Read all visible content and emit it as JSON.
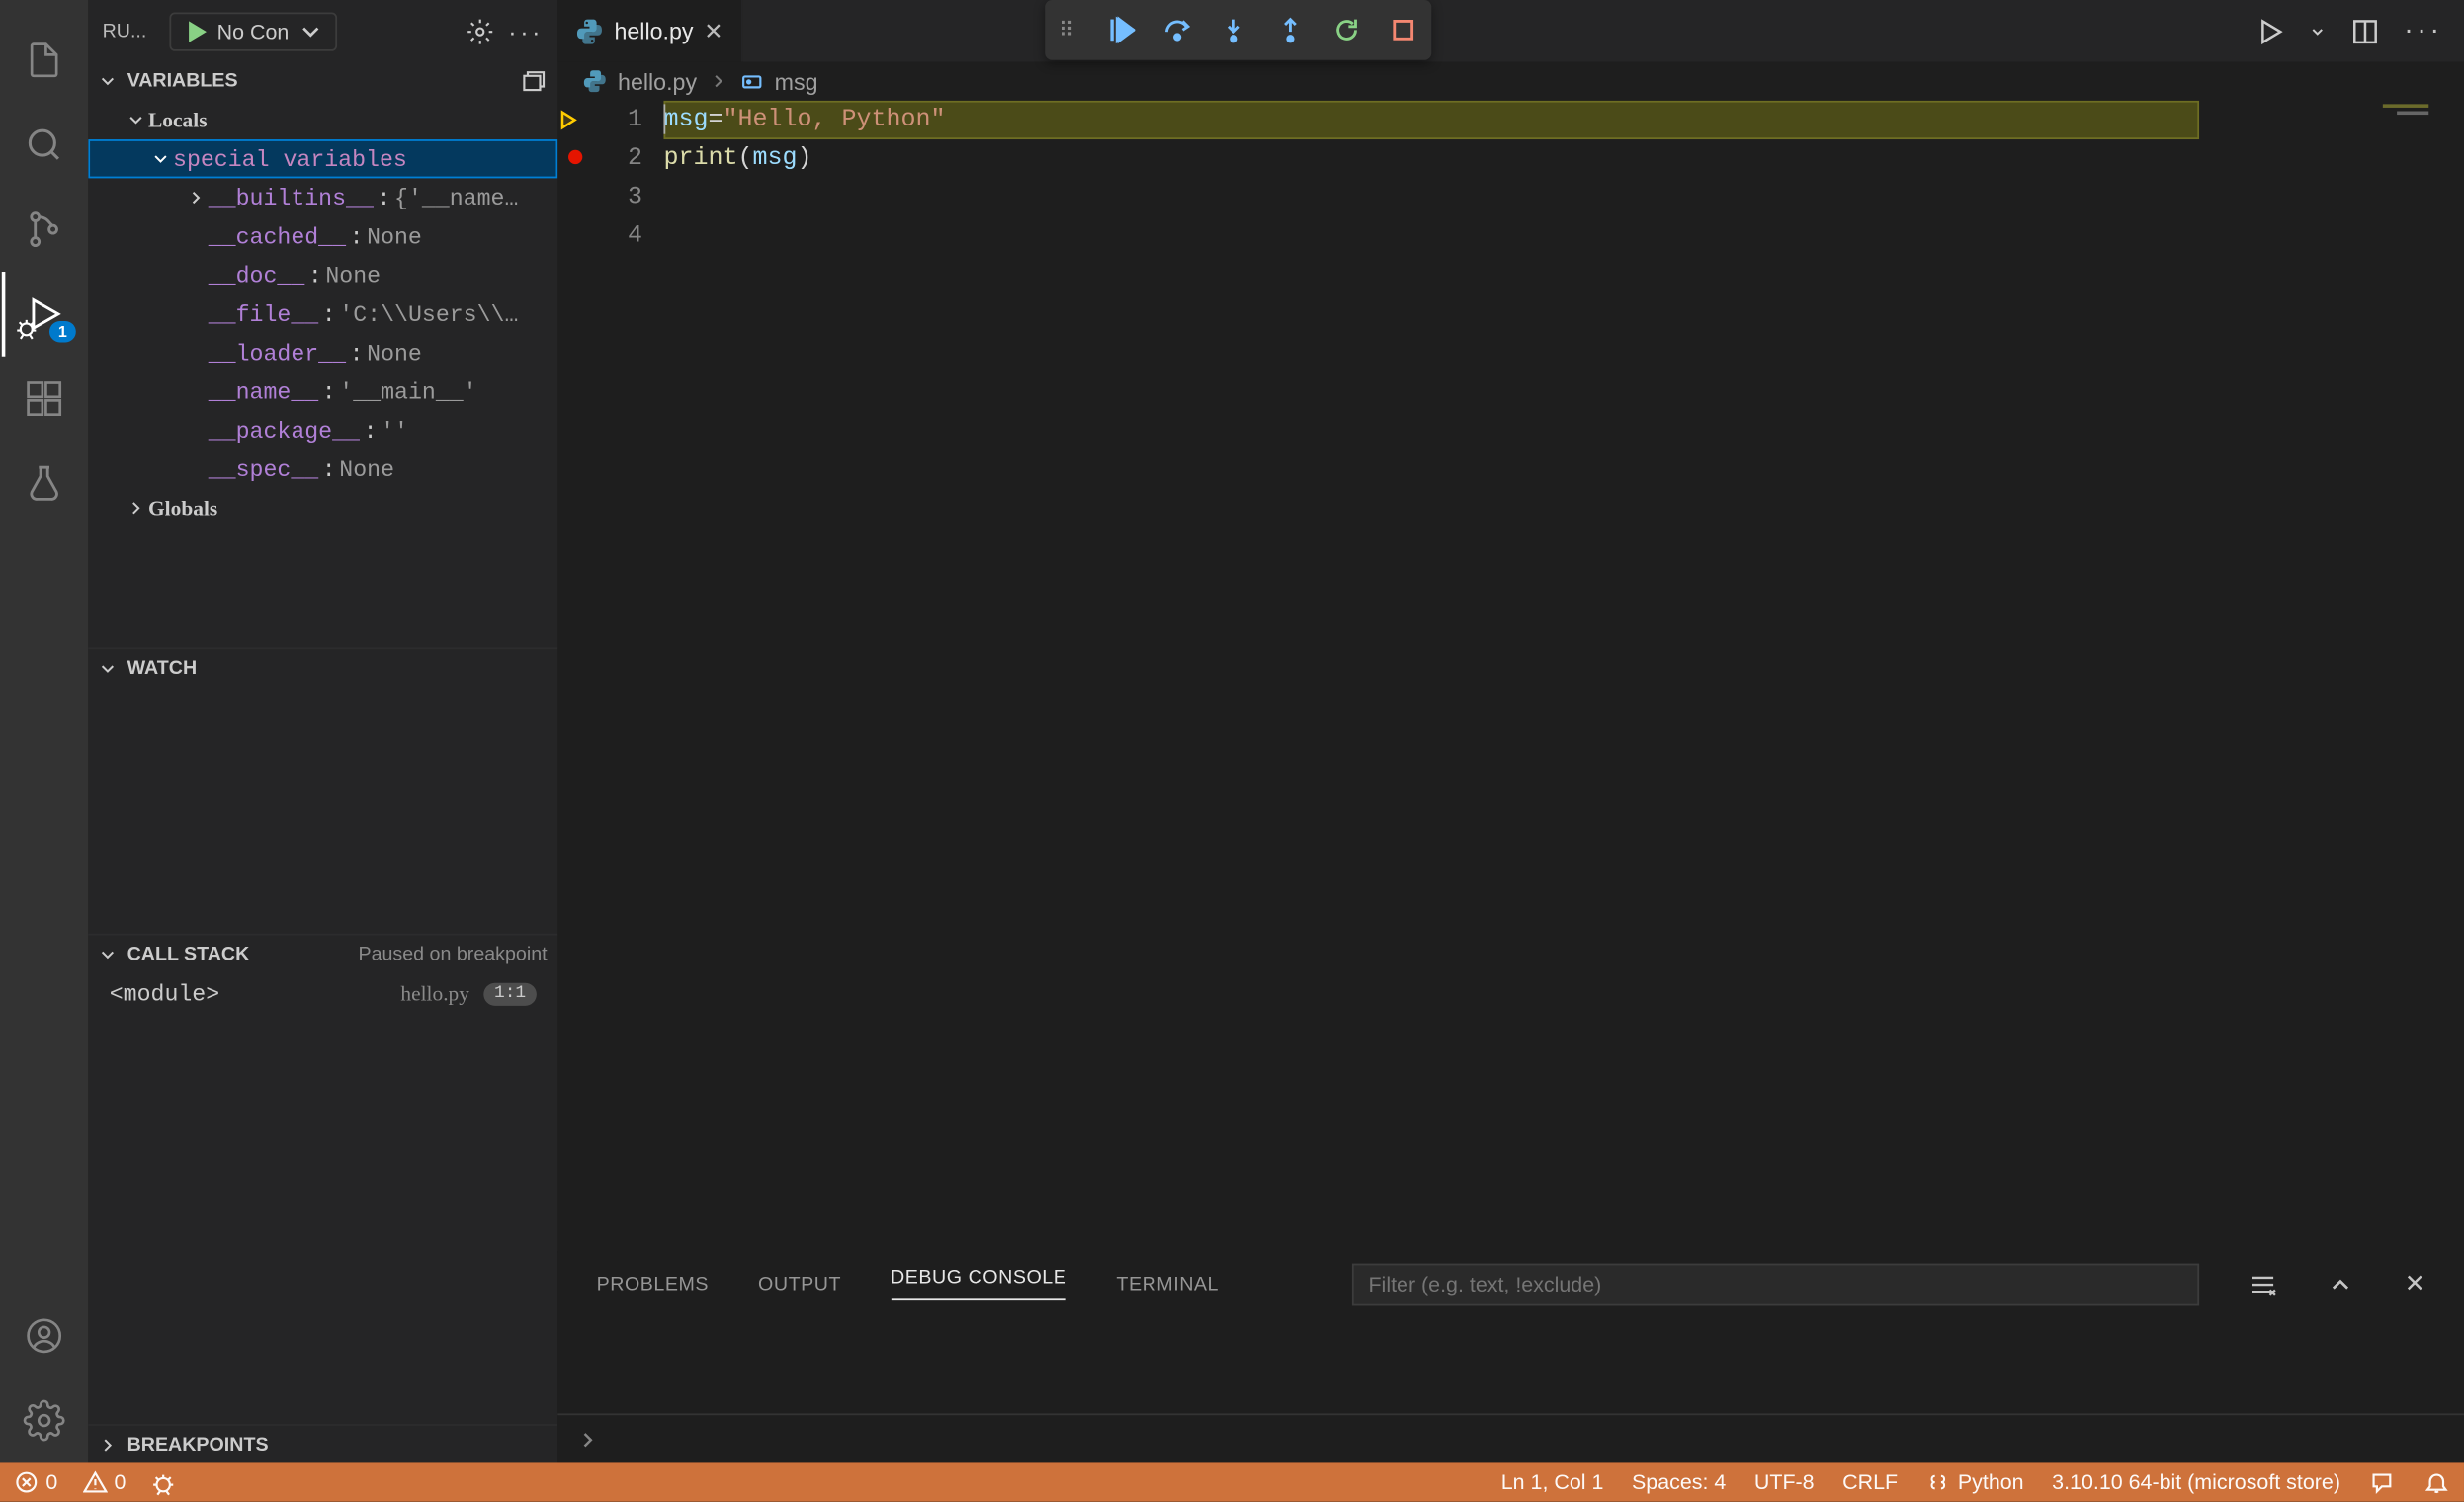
{
  "sidebar": {
    "viewTitle": "RU...",
    "configLabel": "No Con",
    "sections": {
      "variables": "VARIABLES",
      "watch": "WATCH",
      "callstack": "CALL STACK",
      "callstackState": "Paused on breakpoint",
      "breakpoints": "BREAKPOINTS"
    },
    "scopes": {
      "locals": "Locals",
      "globals": "Globals",
      "special": "special variables"
    },
    "vars": [
      {
        "name": "__builtins__",
        "val": "{'__name…"
      },
      {
        "name": "__cached__",
        "val": "None"
      },
      {
        "name": "__doc__",
        "val": "None"
      },
      {
        "name": "__file__",
        "val": "'C:\\\\Users\\\\…"
      },
      {
        "name": "__loader__",
        "val": "None"
      },
      {
        "name": "__name__",
        "val": "'__main__'"
      },
      {
        "name": "__package__",
        "val": "''"
      },
      {
        "name": "__spec__",
        "val": "None"
      }
    ],
    "callstack": {
      "frame": "<module>",
      "file": "hello.py",
      "loc": "1:1"
    }
  },
  "debugBadge": "1",
  "editor": {
    "tabName": "hello.py",
    "breadcrumbFile": "hello.py",
    "breadcrumbSym": "msg",
    "lines": {
      "l1_var": "msg",
      "l1_eq": " = ",
      "l1_str": "\"Hello, Python\"",
      "l2_fn": "print",
      "l2_open": "(",
      "l2_arg": "msg",
      "l2_close": ")",
      "nums": [
        "1",
        "2",
        "3",
        "4"
      ]
    }
  },
  "panel": {
    "tabs": {
      "problems": "PROBLEMS",
      "output": "OUTPUT",
      "debug": "DEBUG CONSOLE",
      "terminal": "TERMINAL"
    },
    "filterPlaceholder": "Filter (e.g. text, !exclude)"
  },
  "status": {
    "errors": "0",
    "warnings": "0",
    "lncol": "Ln 1, Col 1",
    "spaces": "Spaces: 4",
    "encoding": "UTF-8",
    "eol": "CRLF",
    "lang": "Python",
    "interp": "3.10.10 64-bit (microsoft store)"
  }
}
